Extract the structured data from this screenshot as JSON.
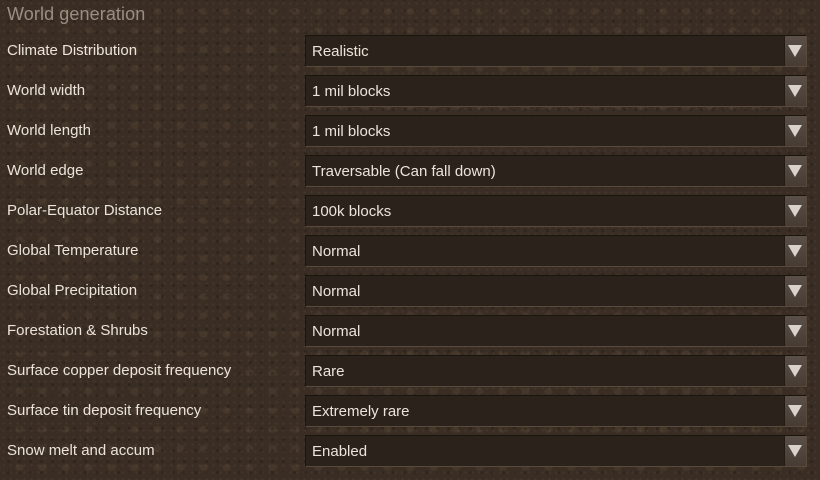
{
  "section_title": "World generation",
  "settings": [
    {
      "label": "Climate Distribution",
      "value": "Realistic"
    },
    {
      "label": "World width",
      "value": "1 mil blocks"
    },
    {
      "label": "World length",
      "value": "1 mil blocks"
    },
    {
      "label": "World edge",
      "value": "Traversable (Can fall down)"
    },
    {
      "label": "Polar-Equator Distance",
      "value": "100k blocks"
    },
    {
      "label": "Global Temperature",
      "value": "Normal"
    },
    {
      "label": "Global Precipitation",
      "value": "Normal"
    },
    {
      "label": "Forestation & Shrubs",
      "value": "Normal"
    },
    {
      "label": "Surface copper deposit frequency",
      "value": "Rare"
    },
    {
      "label": "Surface tin deposit frequency",
      "value": "Extremely rare"
    },
    {
      "label": "Snow melt and accum",
      "value": "Enabled"
    }
  ],
  "icons": {
    "dropdown": "chevron-down-icon"
  },
  "colors": {
    "background": "#3a2e24",
    "field_background": "#2b221b",
    "text": "#ece4da",
    "title_text": "#9a8f84",
    "arrow_button": "#5b5048"
  }
}
